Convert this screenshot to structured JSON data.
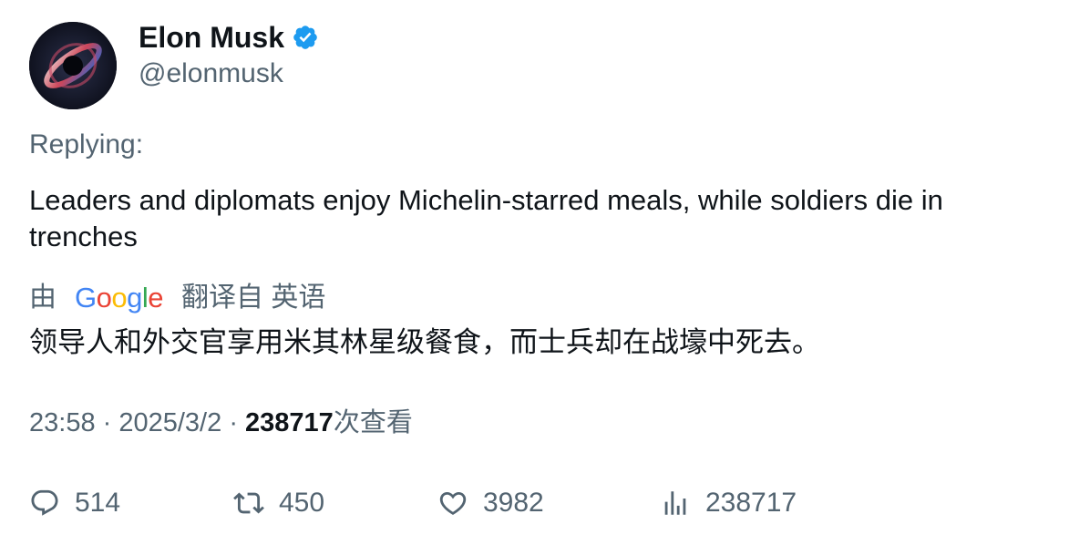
{
  "author": {
    "name": "Elon Musk",
    "handle": "@elonmusk",
    "verified": true
  },
  "tweet": {
    "replying_label": "Replying:",
    "text": "Leaders and diplomats enjoy Michelin-starred meals, while soldiers die in trenches",
    "translation": {
      "prefix": "由",
      "provider": "Google",
      "suffix": "翻译自 英语",
      "text": "领导人和外交官享用米其林星级餐食，而士兵却在战壕中死去。"
    },
    "meta": {
      "time": "23:58",
      "separator": "·",
      "date": "2025/3/2",
      "views_count": "238717",
      "views_label": "次查看"
    }
  },
  "actions": {
    "replies": "514",
    "retweets": "450",
    "likes": "3982",
    "views": "238717"
  },
  "icons": {
    "verified": "verified-badge-icon",
    "reply": "reply-icon",
    "retweet": "retweet-icon",
    "like": "heart-icon",
    "views": "views-chart-icon"
  },
  "colors": {
    "verified_blue": "#1d9bf0",
    "secondary_text": "#536471",
    "primary_text": "#0f1419"
  }
}
